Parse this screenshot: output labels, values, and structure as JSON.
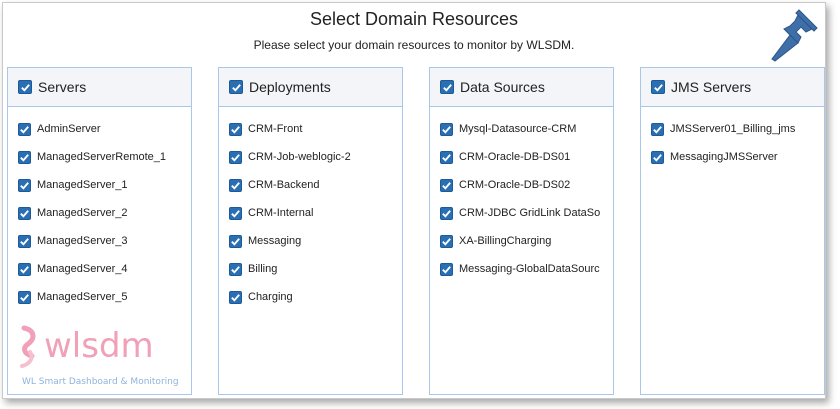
{
  "dialog": {
    "title": "Select Domain Resources",
    "subtitle": "Please select your domain resources to monitor by WLSDM."
  },
  "columns": [
    {
      "header": "Servers",
      "items": [
        "AdminServer",
        "ManagedServerRemote_1",
        "ManagedServer_1",
        "ManagedServer_2",
        "ManagedServer_3",
        "ManagedServer_4",
        "ManagedServer_5"
      ]
    },
    {
      "header": "Deployments",
      "items": [
        "CRM-Front",
        "CRM-Job-weblogic-2",
        "CRM-Backend",
        "CRM-Internal",
        "Messaging",
        "Billing",
        "Charging"
      ]
    },
    {
      "header": "Data Sources",
      "items": [
        "Mysql-Datasource-CRM",
        "CRM-Oracle-DB-DS01",
        "CRM-Oracle-DB-DS02",
        "CRM-JDBC GridLink DataSo",
        "XA-BillingCharging",
        "Messaging-GlobalDataSourc"
      ]
    },
    {
      "header": "JMS Servers",
      "items": [
        "JMSServer01_Billing_jms",
        "MessagingJMSServer"
      ]
    }
  ],
  "logo": {
    "wordmark": "wlsdm",
    "tagline": "WL Smart Dashboard & Monitoring"
  },
  "colors": {
    "accent": "#2a6fb3",
    "border": "#a9c7ea",
    "pin": "#3f6fa8"
  }
}
